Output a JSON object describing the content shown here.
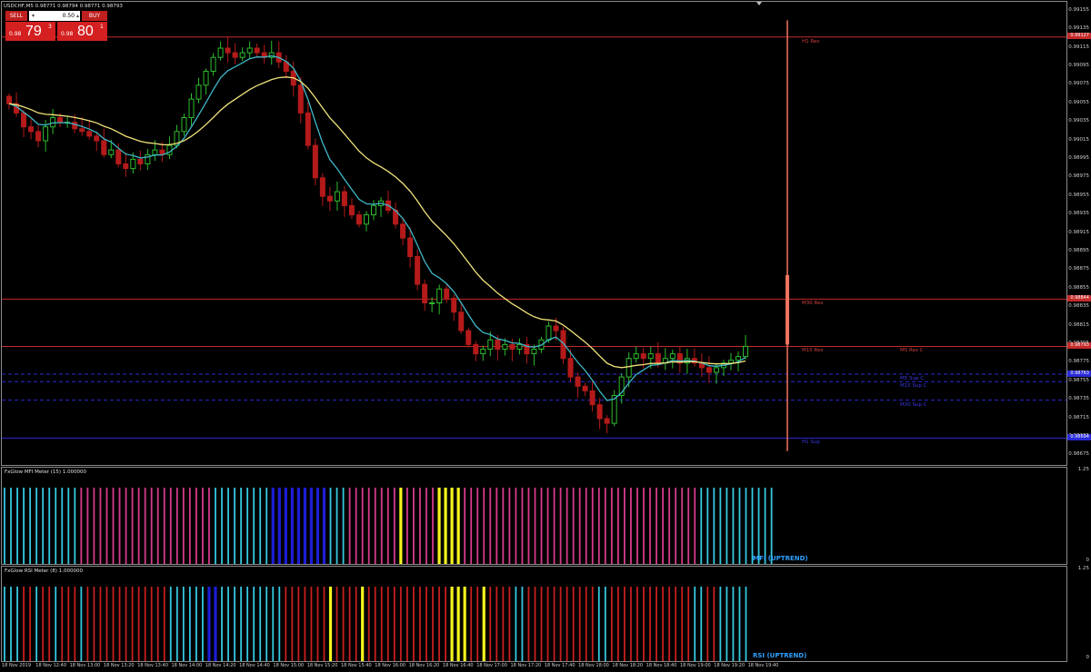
{
  "symbol_header": "USDCHF,M5  0.98771 0.98794 0.98771 0.98793",
  "trade": {
    "sell_label": "SELL",
    "buy_label": "BUY",
    "lot_value": "0.50",
    "lot_decrease": "▾",
    "lot_increase": "▴",
    "sell_small": "0.98",
    "sell_big": "79",
    "sell_sup": "3",
    "buy_small": "0.98",
    "buy_big": "80",
    "buy_sup": "1"
  },
  "price_axis": [
    "0.99155",
    "0.99135",
    "0.99115",
    "0.99095",
    "0.99075",
    "0.99055",
    "0.99035",
    "0.99015",
    "0.98995",
    "0.98975",
    "0.98955",
    "0.98935",
    "0.98915",
    "0.98895",
    "0.98875",
    "0.98855",
    "0.98835",
    "0.98815",
    "0.98795",
    "0.98775",
    "0.98755",
    "0.98735",
    "0.98715",
    "0.98695",
    "0.98675"
  ],
  "price_min": 0.98665,
  "price_max": 0.99165,
  "levels": [
    {
      "price": 0.99127,
      "color": "#c42a2a",
      "style": "solid",
      "tag": "0.99127",
      "labels": [
        {
          "text": "H1 Res",
          "pos": "mid"
        }
      ]
    },
    {
      "price": 0.98844,
      "color": "#c42a2a",
      "style": "solid",
      "tag": "0.98844",
      "labels": [
        {
          "text": "M30 Res",
          "pos": "mid"
        }
      ]
    },
    {
      "price": 0.98793,
      "color": "#c42a2a",
      "style": "solid",
      "tag": "0.98793",
      "labels": [
        {
          "text": "M15 Res",
          "pos": "mid"
        },
        {
          "text": "M5 Res C",
          "pos": "right"
        }
      ]
    },
    {
      "price": 0.98763,
      "color": "#2a2ad8",
      "style": "dashed",
      "tag": "0.98763",
      "labels": [
        {
          "text": "M5 Sup C",
          "pos": "right"
        }
      ]
    },
    {
      "price": 0.98755,
      "color": "#2a2ad8",
      "style": "dashed",
      "tag": "",
      "labels": [
        {
          "text": "M15 Sup C",
          "pos": "right"
        }
      ]
    },
    {
      "price": 0.98735,
      "color": "#2a2ad8",
      "style": "dashed",
      "tag": "",
      "labels": [
        {
          "text": "M30 Sup C",
          "pos": "right"
        }
      ]
    },
    {
      "price": 0.98694,
      "color": "#2a2ad8",
      "style": "solid",
      "tag": "0.98694",
      "labels": [
        {
          "text": "H1 Sup",
          "pos": "mid"
        }
      ]
    }
  ],
  "mfi": {
    "title": "FxGlow MFI Meter (15) 1.000000",
    "state": "MFI (UPTREND)",
    "scale_top": "1.25",
    "scale_bottom": "0",
    "colors": "CCCCCCCCCCCCMMMMMMMMMMMMMMMMMMMMMCCCCCCCCCBBBBBBBBBCCCMMMMMMMMYMMMMMYYYYMMMMMMMMMMMMMMMMMMMMMMMMMMMMMMMMMMMMMCCCCCCCCCCCC"
  },
  "rsi": {
    "title": "FxGlow RSI Meter (8) 1.000000",
    "state": "RSI (UPTREND)",
    "scale_top": "1.25",
    "scale_bottom": "0",
    "colors": "CCCRRCRRCRRRCRRRRRRRRRRRRRCCCCCCBBCCCCCCCCCCRRRRRRRYRRRRYRRRRRRRRRRRRRYYYRRYRRRRCCRRRRRRRRRRRCCRRRRRRRRRRRRRCCRRCCCCC"
  },
  "palette": {
    "C": "#35c8e0",
    "M": "#d63b8c",
    "B": "#1d1dd6",
    "Y": "#f4f41e",
    "R": "#c61f1f",
    "bull": "#2dbb2d",
    "bear": "#b51a1a",
    "ma_fast": "#3fb8c8",
    "ma_slow": "#f1e37a",
    "vline": "#f07460"
  },
  "time_axis": [
    "18 Nov 2019",
    "18 Nov 12:40",
    "18 Nov 13:00",
    "18 Nov 13:20",
    "18 Nov 13:40",
    "18 Nov 14:00",
    "18 Nov 14:20",
    "18 Nov 14:40",
    "18 Nov 15:00",
    "18 Nov 15:20",
    "18 Nov 15:40",
    "18 Nov 16:00",
    "18 Nov 16:20",
    "18 Nov 16:40",
    "18 Nov 17:00",
    "18 Nov 17:20",
    "18 Nov 17:40",
    "18 Nov 18:00",
    "18 Nov 18:20",
    "18 Nov 18:40",
    "18 Nov 19:00",
    "18 Nov 19:20",
    "18 Nov 19:40"
  ],
  "chart_data": {
    "type": "candlestick",
    "symbol": "USDCHF",
    "timeframe": "M5",
    "close_path": [
      0.99055,
      0.99045,
      0.9903,
      0.99025,
      0.99015,
      0.9903,
      0.9904,
      0.99035,
      0.99035,
      0.99028,
      0.99025,
      0.9902,
      0.99015,
      0.99,
      0.99005,
      0.9899,
      0.98985,
      0.98995,
      0.9899,
      0.99,
      0.99005,
      0.99,
      0.9901,
      0.99025,
      0.9904,
      0.9906,
      0.99075,
      0.9909,
      0.99105,
      0.99115,
      0.9911,
      0.99105,
      0.9911,
      0.99115,
      0.9911,
      0.99105,
      0.9911,
      0.991,
      0.9909,
      0.99075,
      0.99045,
      0.9901,
      0.98975,
      0.98955,
      0.9895,
      0.9896,
      0.98945,
      0.98935,
      0.98925,
      0.98935,
      0.98945,
      0.9895,
      0.9894,
      0.98925,
      0.9891,
      0.9889,
      0.9886,
      0.9884,
      0.9884,
      0.98855,
      0.98845,
      0.9883,
      0.9881,
      0.98795,
      0.98785,
      0.9879,
      0.988,
      0.9879,
      0.98795,
      0.9879,
      0.98795,
      0.98785,
      0.9879,
      0.988,
      0.98815,
      0.9881,
      0.9878,
      0.9876,
      0.9875,
      0.98745,
      0.9873,
      0.98715,
      0.9871,
      0.9874,
      0.9876,
      0.9878,
      0.98785,
      0.9878,
      0.98785,
      0.98775,
      0.9878,
      0.98785,
      0.98775,
      0.9878,
      0.98775,
      0.9877,
      0.98765,
      0.9877,
      0.98775,
      0.98778,
      0.98782,
      0.98793
    ],
    "volatility_bar": {
      "time_index": 103,
      "high": 0.99145,
      "low": 0.9868,
      "body_high": 0.9887,
      "body_low": 0.98795
    }
  }
}
